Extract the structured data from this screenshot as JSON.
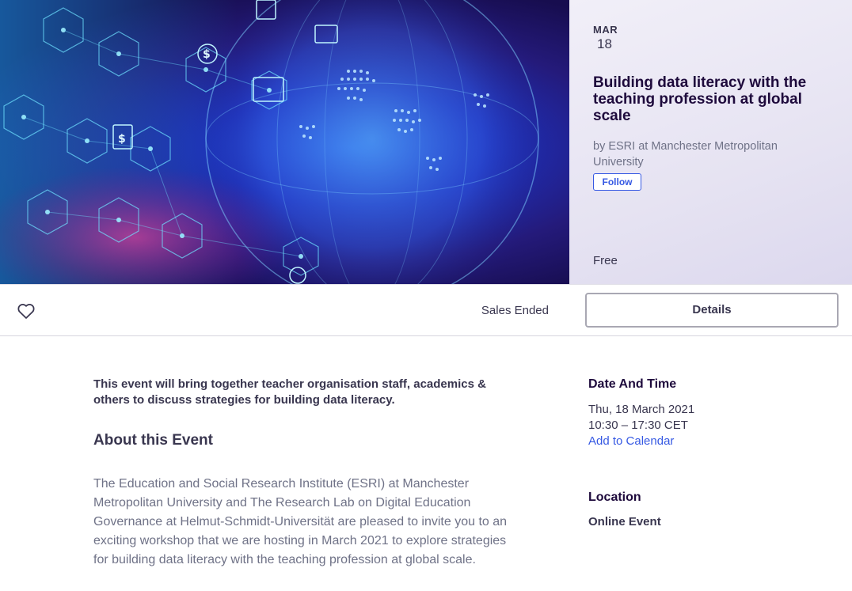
{
  "event": {
    "month": "MAR",
    "day": "18",
    "title": "Building data literacy with the teaching profession at global scale",
    "organizer": "by ESRI at Manchester Metropolitan University",
    "follow_label": "Follow",
    "price": "Free"
  },
  "action_bar": {
    "like_icon": "heart-icon",
    "sales_status": "Sales Ended",
    "details_label": "Details"
  },
  "content": {
    "summary": "This event will bring together teacher organisation staff, academics & others to discuss strategies for building data literacy.",
    "about_heading": "About this Event",
    "description": "The Education and Social Research Institute (ESRI) at Manchester Metropolitan University and The Research Lab on Digital Education Governance at Helmut-Schmidt-Universität are pleased to invite you to an exciting workshop that we are hosting in March 2021 to explore strategies for building data literacy with the teaching profession at global scale."
  },
  "sidebar": {
    "date_heading": "Date And Time",
    "date": "Thu, 18 March 2021",
    "time": "10:30 – 17:30 CET",
    "add_to_calendar": "Add to Calendar",
    "location_heading": "Location",
    "location": "Online Event"
  },
  "colors": {
    "accent": "#3659e3",
    "title": "#1e0a3c",
    "text": "#39364f",
    "muted": "#6f7287"
  }
}
